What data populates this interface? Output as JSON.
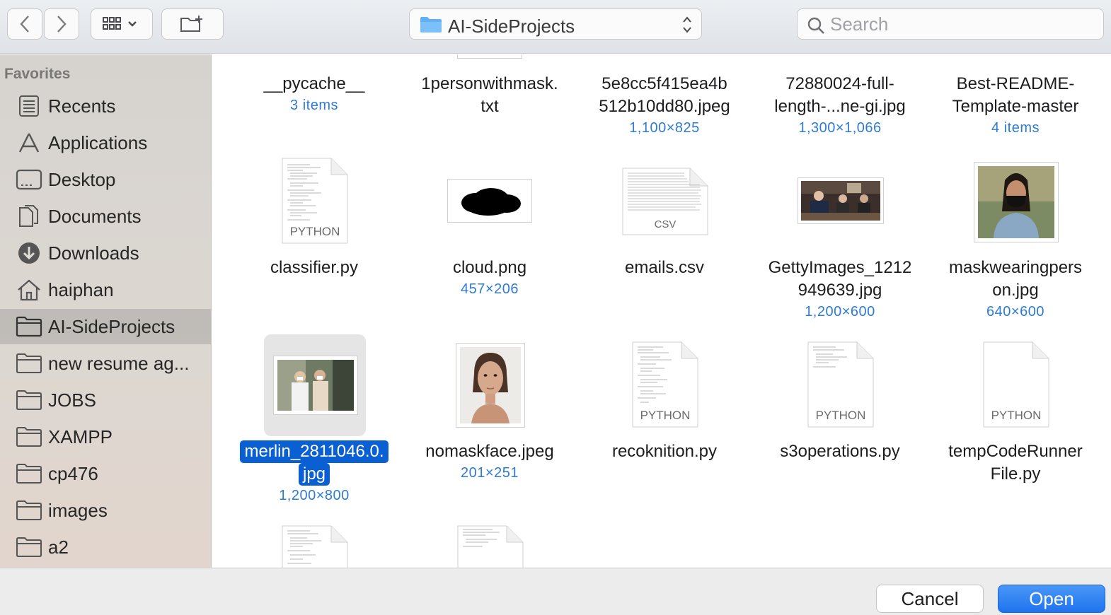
{
  "toolbar": {
    "back_icon": "chevron-left-icon",
    "forward_icon": "chevron-right-icon",
    "view_icon": "icon-grid-icon",
    "new_folder_icon": "new-folder-icon",
    "path_label": "AI-SideProjects",
    "search_placeholder": "Search"
  },
  "sidebar": {
    "heading": "Favorites",
    "items": [
      {
        "label": "Recents",
        "icon": "recents-icon"
      },
      {
        "label": "Applications",
        "icon": "applications-icon"
      },
      {
        "label": "Desktop",
        "icon": "desktop-icon"
      },
      {
        "label": "Documents",
        "icon": "documents-icon"
      },
      {
        "label": "Downloads",
        "icon": "downloads-icon"
      },
      {
        "label": "haiphan",
        "icon": "home-icon"
      },
      {
        "label": "AI-SideProjects",
        "icon": "folder-icon",
        "selected": true
      },
      {
        "label": "new resume ag...",
        "icon": "folder-icon"
      },
      {
        "label": "JOBS",
        "icon": "folder-icon"
      },
      {
        "label": "XAMPP",
        "icon": "folder-icon"
      },
      {
        "label": "cp476",
        "icon": "folder-icon"
      },
      {
        "label": "images",
        "icon": "folder-icon"
      },
      {
        "label": "a2",
        "icon": "folder-icon"
      }
    ]
  },
  "files": {
    "row1": [
      {
        "name1": "__pycache__",
        "name2": "",
        "meta": "3 items"
      },
      {
        "name1": "1personwithmask.",
        "name2": "txt",
        "meta": ""
      },
      {
        "name1": "5e8cc5f415ea4b",
        "name2": "512b10dd80.jpeg",
        "meta": "1,100×825"
      },
      {
        "name1": "72880024-full-",
        "name2": "length-...ne-gi.jpg",
        "meta": "1,300×1,066"
      },
      {
        "name1": "Best-README-",
        "name2": "Template-master",
        "meta": "4 items"
      }
    ],
    "row2": [
      {
        "name1": "classifier.py",
        "name2": "",
        "meta": "",
        "tag": "PYTHON"
      },
      {
        "name1": "cloud.png",
        "name2": "",
        "meta": "457×206"
      },
      {
        "name1": "emails.csv",
        "name2": "",
        "meta": "",
        "tag": "CSV"
      },
      {
        "name1": "GettyImages_1212",
        "name2": "949639.jpg",
        "meta": "1,200×600"
      },
      {
        "name1": "maskwearingpers",
        "name2": "on.jpg",
        "meta": "640×600"
      }
    ],
    "row3": [
      {
        "name1": "merlin_2811046.0.",
        "name2": "jpg",
        "meta": "1,200×800",
        "selected": true
      },
      {
        "name1": "nomaskface.jpeg",
        "name2": "",
        "meta": "201×251"
      },
      {
        "name1": "recoknition.py",
        "name2": "",
        "meta": "",
        "tag": "PYTHON"
      },
      {
        "name1": "s3operations.py",
        "name2": "",
        "meta": "",
        "tag": "PYTHON"
      },
      {
        "name1": "tempCodeRunner",
        "name2": "File.py",
        "meta": "",
        "tag": "PYTHON"
      }
    ]
  },
  "buttons": {
    "cancel": "Cancel",
    "open": "Open"
  },
  "colors": {
    "accent": "#1f73ee",
    "selection": "#0a5fd3",
    "meta_text": "#2e7bd6"
  }
}
